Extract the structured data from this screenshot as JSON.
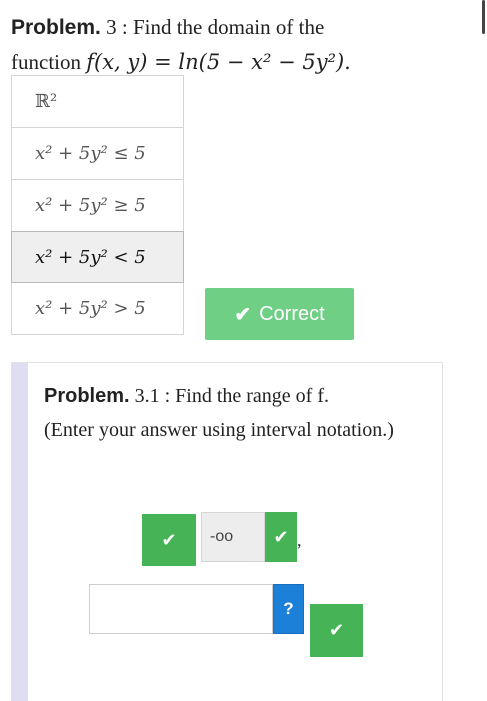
{
  "problem": {
    "label": "Problem.",
    "number": "3",
    "text_part1": "Find the domain of the",
    "text_part2": "function",
    "function_expr": "f(x, y) = ln(5 − x² − 5y²)."
  },
  "options": [
    {
      "text": "ℝ²",
      "selected": false
    },
    {
      "text": "x² + 5y² ≤ 5",
      "selected": false
    },
    {
      "text": "x² + 5y² ≥ 5",
      "selected": false
    },
    {
      "text": "x² + 5y² < 5",
      "selected": true
    },
    {
      "text": "x² + 5y² > 5",
      "selected": false
    }
  ],
  "result": {
    "label": "Correct",
    "icon": "check-icon"
  },
  "subproblem": {
    "label": "Problem.",
    "number": "3.1",
    "text": "Find the range of f.",
    "instruction": "(Enter your answer using interval notation.)",
    "lower_bound_value": "-oo",
    "comma": ",",
    "help_label": "?",
    "answer_value": "",
    "check_glyph": "✔"
  },
  "colors": {
    "correct_bg": "#6fcf85",
    "check_green": "#46b456",
    "help_blue": "#1c7fd8",
    "stripe": "#dedef0"
  }
}
